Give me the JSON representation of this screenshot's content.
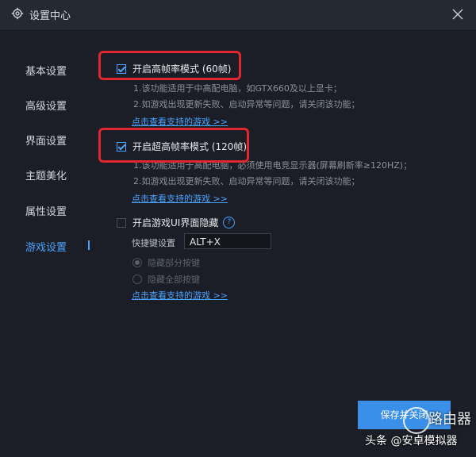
{
  "window": {
    "title": "设置中心",
    "icons": {
      "settings": "gear-icon",
      "close": "close-icon"
    }
  },
  "sidebar": {
    "items": [
      {
        "label": "基本设置",
        "active": false
      },
      {
        "label": "高级设置",
        "active": false
      },
      {
        "label": "界面设置",
        "active": false
      },
      {
        "label": "主题美化",
        "active": false
      },
      {
        "label": "属性设置",
        "active": false
      },
      {
        "label": "游戏设置",
        "active": true
      }
    ]
  },
  "game": {
    "option60": {
      "label": "开启高帧率模式 (60帧)",
      "checked": true,
      "notes": [
        "1.该功能适用于中高配电脑，如GTX660及以上显卡；",
        "2.如游戏出现更新失败、启动异常等问题，请关闭该功能；"
      ],
      "link": "点击查看支持的游戏 >>"
    },
    "option120": {
      "label": "开启超高帧率模式 (120帧)",
      "checked": true,
      "notes": [
        "1.该功能适用于高配电脑，必须使用电竞显示器(屏幕刷新率≥120HZ)；",
        "2.如游戏出现更新失败、启动异常等问题，请关闭该功能；"
      ],
      "link": "点击查看支持的游戏 >>"
    },
    "ui_hide": {
      "label": "开启游戏UI界面隐藏",
      "checked": false,
      "help_icon": "question-icon",
      "help_text": "?",
      "hotkey_label": "快捷键设置",
      "hotkey_value": "ALT+X",
      "radios": [
        {
          "label": "隐藏部分按键",
          "selected": true
        },
        {
          "label": "隐藏全部按键",
          "selected": false
        }
      ],
      "link": "点击查看支持的游戏 >>"
    }
  },
  "footer": {
    "save_label": "保存并关闭"
  },
  "watermark": {
    "line1": "路由器",
    "line2": "头条 @安卓模拟器"
  },
  "colors": {
    "accent": "#4aa3ff",
    "highlight": "#e0262e",
    "background": "#1b1e26",
    "button": "#3a8fe8"
  }
}
